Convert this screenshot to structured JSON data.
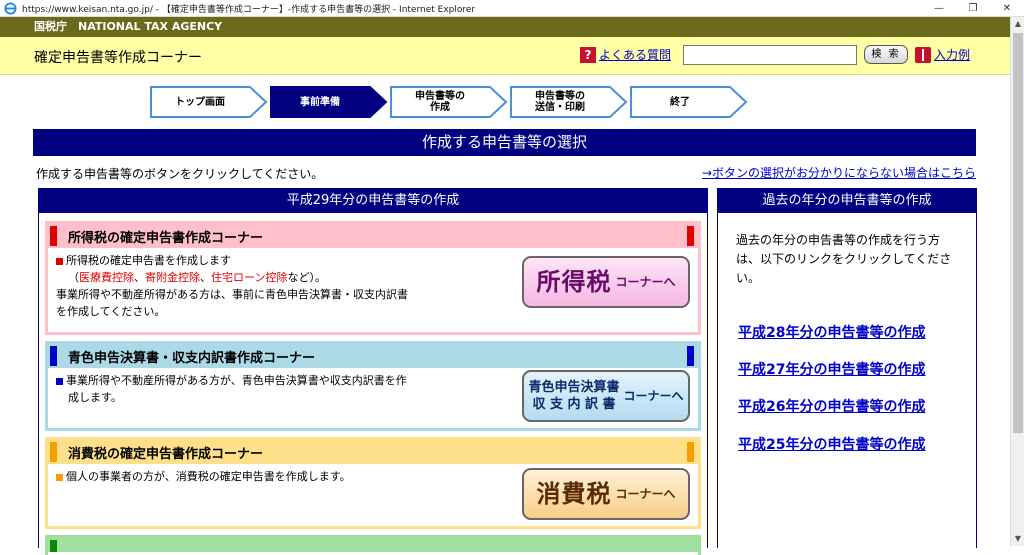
{
  "window": {
    "title": "https://www.keisan.nta.go.jp/ - 【確定申告書等作成コーナー】-作成する申告書等の選択 - Internet Explorer",
    "minimize": "—",
    "restore": "❐",
    "close": "✕"
  },
  "header": {
    "agency": "国税庁　NATIONAL TAX AGENCY",
    "corner_title": "確定申告書等作成コーナー",
    "faq_label": "よくある質問",
    "faq_icon": "?",
    "search_value": "",
    "search_button": "検 索",
    "example_label": "入力例"
  },
  "steps": [
    {
      "label": "トップ画面",
      "active": false
    },
    {
      "label": "事前準備",
      "active": true
    },
    {
      "label": "申告書等の\n作成",
      "active": false
    },
    {
      "label": "申告書等の\n送信・印刷",
      "active": false
    },
    {
      "label": "終了",
      "active": false
    }
  ],
  "main": {
    "section_title": "作成する申告書等の選択",
    "instruction": "作成する申告書等のボタンをクリックしてください。",
    "help_link": "→ボタンの選択がお分かりにならない場合はこちら"
  },
  "current_year": {
    "title": "平成29年分の申告書等の作成",
    "income_tax": {
      "heading": "所得税の確定申告書作成コーナー",
      "line1": "所得税の確定申告書を作成します",
      "paren_open": "（",
      "item1": "医療費控除",
      "sep1": "、",
      "item2": "寄附金控除",
      "sep2": "、",
      "item3": "住宅ローン控除",
      "paren_close": "など）。",
      "line3": "事業所得や不動産所得がある方は、事前に青色申告決算書・収支内訳書",
      "line4": "を作成してください。",
      "button_main": "所得税",
      "button_sub": "コーナーへ",
      "color": "#ffc0cb"
    },
    "blue_return": {
      "heading": "青色申告決算書・収支内訳書作成コーナー",
      "line1": "事業所得や不動産所得がある方が、青色申告決算書や収支内訳書を作",
      "line2": "成します。",
      "button_line1": "青色申告決算書",
      "button_line2": "収 支 内 訳 書",
      "button_sub": "コーナーへ",
      "color": "#add8e6"
    },
    "consumption_tax": {
      "heading": "消費税の確定申告書作成コーナー",
      "line1": "個人の事業者の方が、消費税の確定申告書を作成します。",
      "button_main": "消費税",
      "button_sub": "コーナーへ",
      "color": "#ffe08a"
    }
  },
  "past_years": {
    "title": "過去の年分の申告書等の作成",
    "description": "過去の年分の申告書等の作成を行う方は、以下のリンクをクリックしてください。",
    "links": [
      "平成28年分の申告書等の作成",
      "平成27年分の申告書等の作成",
      "平成26年分の申告書等の作成",
      "平成25年分の申告書等の作成"
    ]
  }
}
